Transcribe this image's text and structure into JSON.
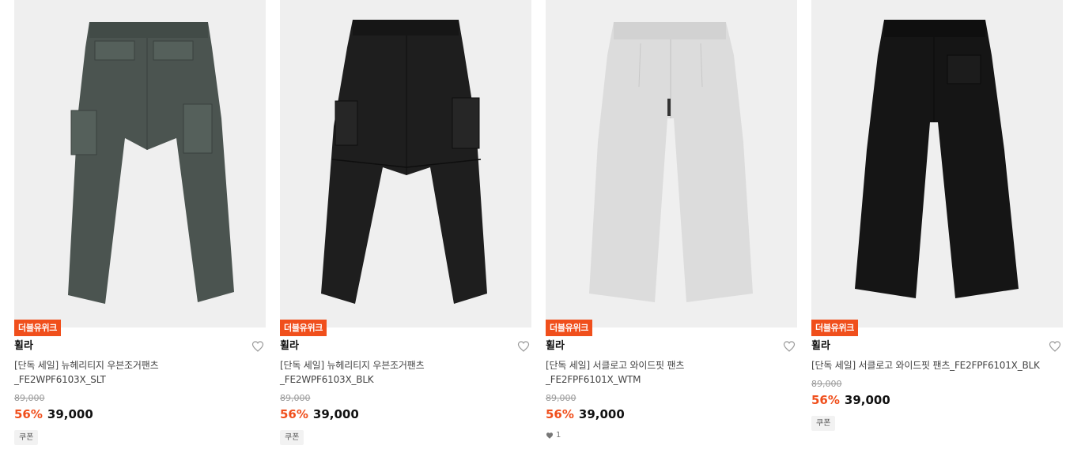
{
  "products": [
    {
      "badge": "더블유위크",
      "brand": "휠라",
      "name_line1": "[단독 세일] 뉴헤리티지 우븐조거팬츠",
      "name_line2": "_FE2WPF6103X_SLT",
      "original_price": "89,000",
      "discount": "56%",
      "price": "39,000",
      "coupon": "쿠폰",
      "image_icon": "cargo-pants-slate",
      "image_color": "#4b5450"
    },
    {
      "badge": "더블유위크",
      "brand": "휠라",
      "name_line1": "[단독 세일] 뉴헤리티지 우븐조거팬츠",
      "name_line2": "_FE2WPF6103X_BLK",
      "original_price": "89,000",
      "discount": "56%",
      "price": "39,000",
      "coupon": "쿠폰",
      "image_icon": "cargo-pants-black",
      "image_color": "#1e1e1e"
    },
    {
      "badge": "더블유위크",
      "brand": "휠라",
      "name_line1": "[단독 세일] 서클로고 와이드핏 팬츠",
      "name_line2": "_FE2FPF6101X_WTM",
      "original_price": "89,000",
      "discount": "56%",
      "price": "39,000",
      "likes": "1",
      "image_icon": "wide-pants-white-melange",
      "image_color": "#dcdcdc"
    },
    {
      "badge": "더블유위크",
      "brand": "휠라",
      "name_line1": "[단독 세일] 서클로고 와이드핏 팬츠_FE2FPF6101X_BLK",
      "original_price": "89,000",
      "discount": "56%",
      "price": "39,000",
      "coupon": "쿠폰",
      "image_icon": "wide-pants-black",
      "image_color": "#151515"
    }
  ],
  "colors": {
    "accent": "#f04f1c",
    "image_bg": "#efefef"
  }
}
